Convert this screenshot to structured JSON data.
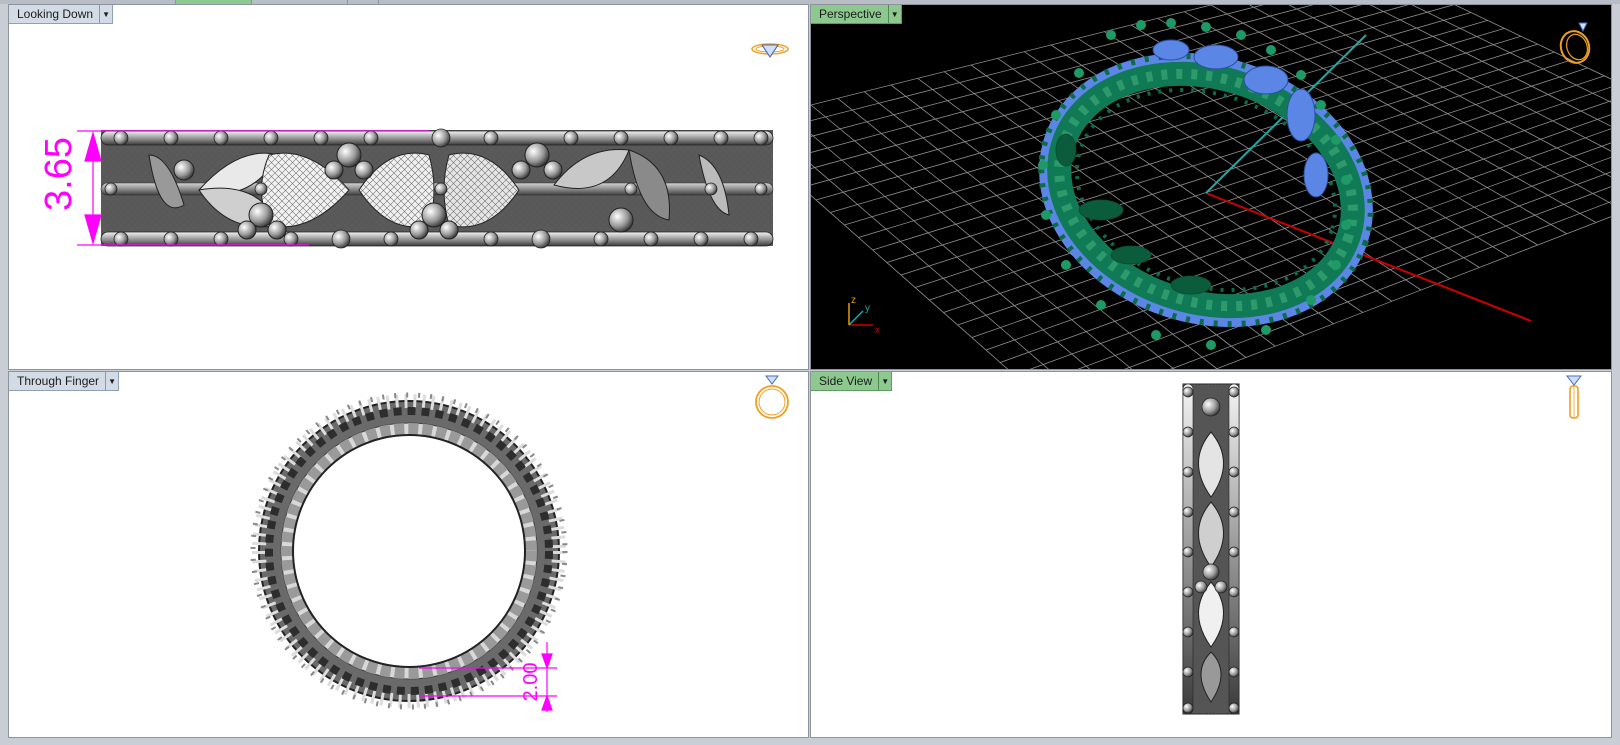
{
  "viewports": [
    {
      "id": "looking-down",
      "label": "Looking Down",
      "active": false
    },
    {
      "id": "perspective",
      "label": "Perspective",
      "active": true
    },
    {
      "id": "through-finger",
      "label": "Through Finger",
      "active": false
    },
    {
      "id": "side-view",
      "label": "Side View",
      "active": true
    }
  ],
  "dimensions": {
    "height": "3.65",
    "thickness": "2.00"
  },
  "axes": {
    "x": "x",
    "y": "y",
    "z": "z"
  },
  "colors": {
    "dimension": "#ff00ff",
    "ring_green": "#0f7a55",
    "stone_blue": "#5b86e6",
    "grid": "#9a9a9a",
    "x_axis": "#cc0000",
    "y_axis": "#1fa8a8",
    "widget_gold": "#f0a020"
  }
}
